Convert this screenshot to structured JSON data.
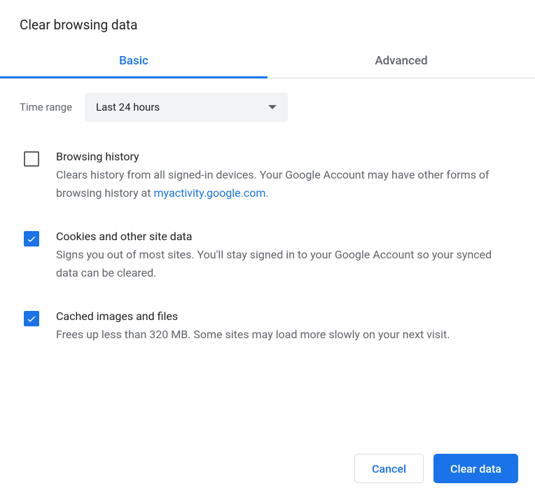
{
  "dialog": {
    "title": "Clear browsing data"
  },
  "tabs": {
    "basic": "Basic",
    "advanced": "Advanced",
    "active": "basic"
  },
  "timeRange": {
    "label": "Time range",
    "selected": "Last 24 hours"
  },
  "options": {
    "browsingHistory": {
      "checked": false,
      "title": "Browsing history",
      "descBefore": "Clears history from all signed-in devices. Your Google Account may have other forms of browsing history at ",
      "link": "myactivity.google.com",
      "descAfter": "."
    },
    "cookies": {
      "checked": true,
      "title": "Cookies and other site data",
      "desc": "Signs you out of most sites. You'll stay signed in to your Google Account so your synced data can be cleared."
    },
    "cache": {
      "checked": true,
      "title": "Cached images and files",
      "desc": "Frees up less than 320 MB. Some sites may load more slowly on your next visit."
    }
  },
  "buttons": {
    "cancel": "Cancel",
    "clearData": "Clear data"
  },
  "colors": {
    "accent": "#1a73e8",
    "textPrimary": "#202124",
    "textSecondary": "#5f6368",
    "border": "#dadce0",
    "selectBg": "#f1f3f4"
  }
}
